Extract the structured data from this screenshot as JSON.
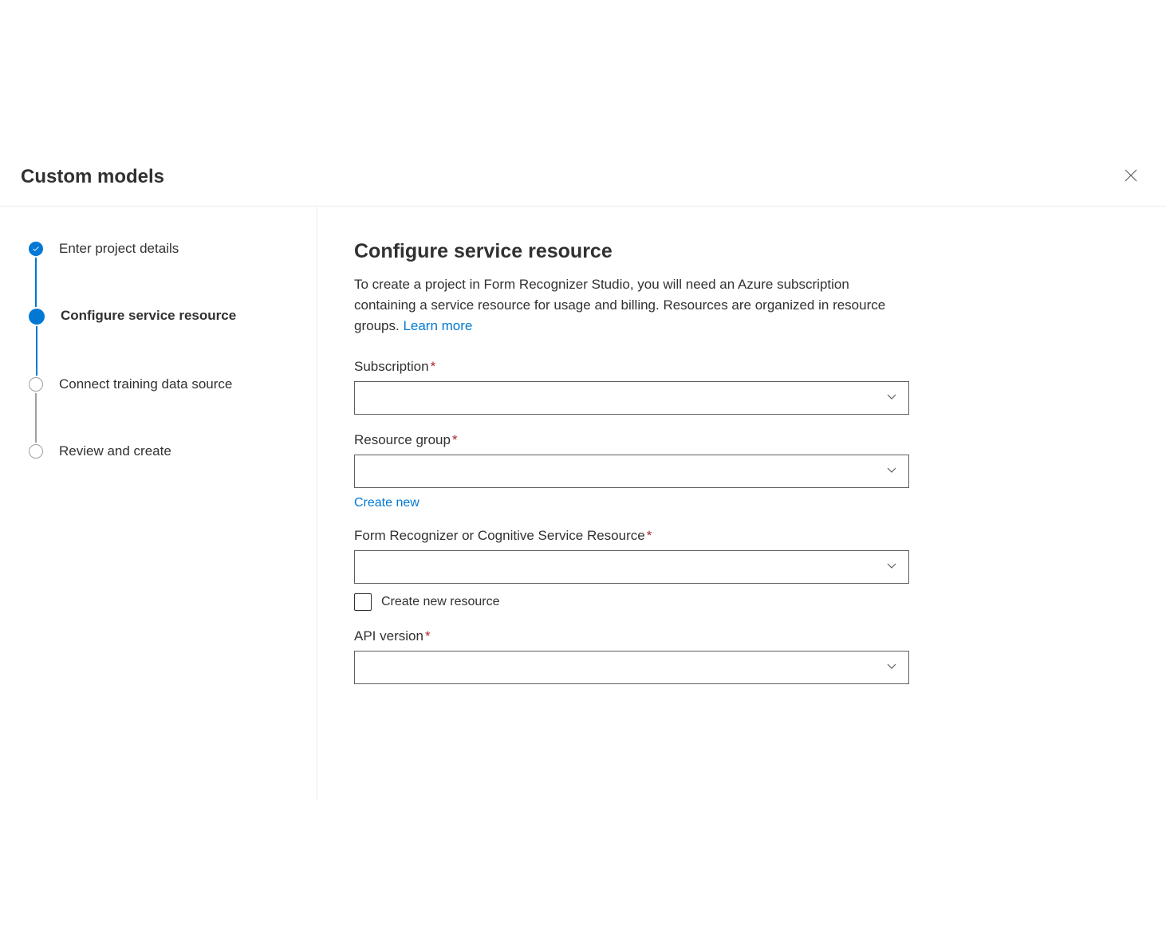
{
  "header": {
    "title": "Custom models"
  },
  "sidebar": {
    "steps": [
      {
        "label": "Enter project details",
        "status": "completed"
      },
      {
        "label": "Configure service resource",
        "status": "current"
      },
      {
        "label": "Connect training data source",
        "status": "upcoming"
      },
      {
        "label": "Review and create",
        "status": "upcoming"
      }
    ]
  },
  "main": {
    "title": "Configure service resource",
    "description_pre": "To create a project in Form Recognizer Studio, you will need an Azure subscription containing a service resource for usage and billing. Resources are organized in resource groups. ",
    "learn_more": "Learn more",
    "fields": {
      "subscription": {
        "label": "Subscription",
        "required": true,
        "value": ""
      },
      "resource_group": {
        "label": "Resource group",
        "required": true,
        "value": "",
        "create_new_label": "Create new"
      },
      "form_recognizer": {
        "label": "Form Recognizer or Cognitive Service Resource",
        "required": true,
        "value": "",
        "checkbox_label": "Create new resource",
        "checkbox_checked": false
      },
      "api_version": {
        "label": "API version",
        "required": true,
        "value": ""
      }
    }
  }
}
